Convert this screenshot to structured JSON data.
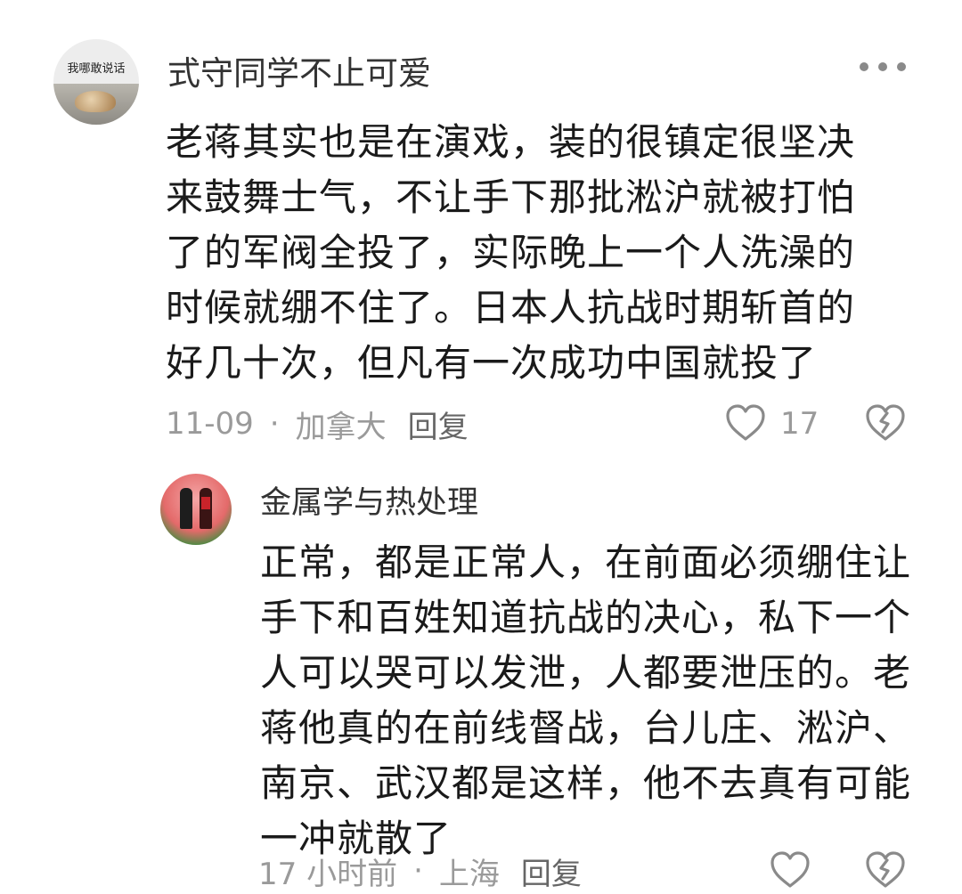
{
  "comment": {
    "avatar_text": "我哪敢说话",
    "username": "式守同学不止可爱",
    "body_lines": [
      "老蒋其实也是在演戏，装的很镇定很坚决",
      "来鼓舞士气，不让手下那批淞沪就被打怕",
      "了的军阀全投了，实际晚上一个人洗澡的",
      "时候就绷不住了。日本人抗战时期斩首的",
      "好几十次，但凡有一次成功中国就投了"
    ],
    "date": "11-09",
    "separator": "·",
    "location": "加拿大",
    "reply_label": "回复",
    "like_count": "17"
  },
  "reply": {
    "username": "金属学与热处理",
    "body_lines": [
      "正常，都是正常人，在前面必须绷住让",
      "手下和百姓知道抗战的决心，私下一个",
      "人可以哭可以发泄，人都要泄压的。老",
      "蒋他真的在前线督战，台儿庄、淞沪、",
      "南京、武汉都是这样，他不去真有可能",
      "一冲就散了"
    ],
    "time": "17 小时前",
    "separator": "·",
    "location": "上海",
    "reply_label": "回复"
  },
  "icons": {
    "more": "more-dots-icon",
    "like": "heart-outline-icon",
    "dislike": "broken-heart-icon"
  },
  "colors": {
    "text_primary": "#1a1a1a",
    "text_secondary": "#9a9a9a",
    "username": "#333333",
    "icon": "#8a8a8a"
  }
}
